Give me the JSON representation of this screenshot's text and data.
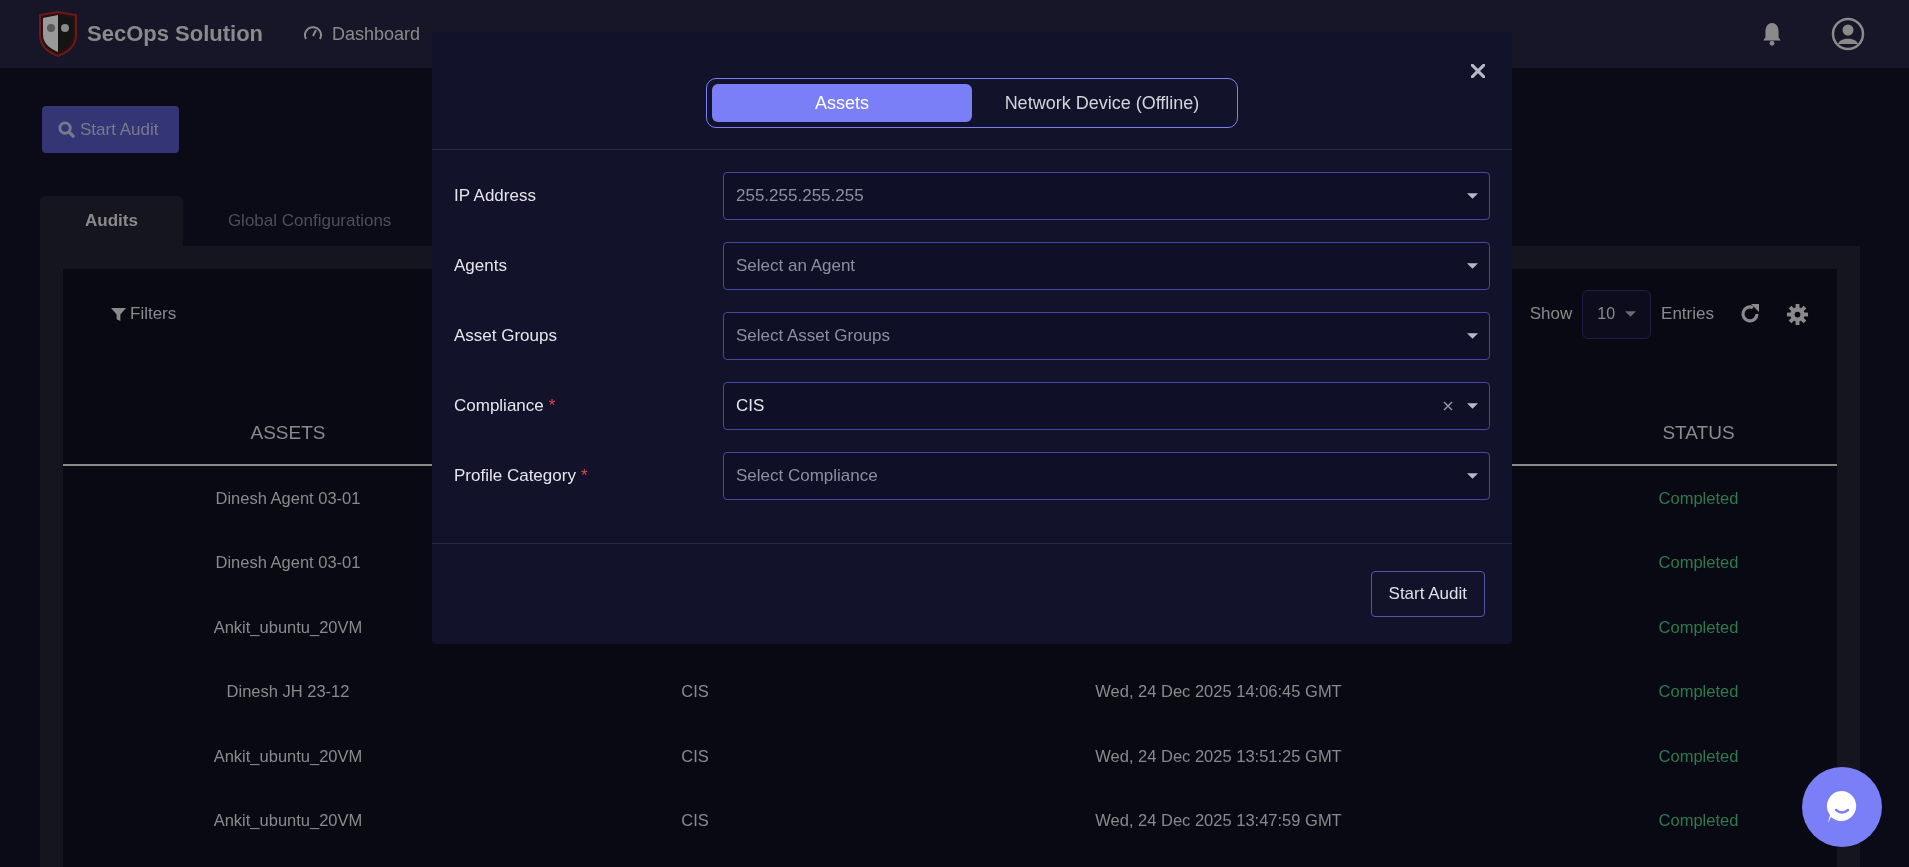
{
  "nav": {
    "brand": "SecOps Solution",
    "items": [
      {
        "label": "Dashboard"
      }
    ]
  },
  "start_audit_button": "Start Audit",
  "tabs": [
    {
      "label": "Audits",
      "selected": true
    },
    {
      "label": "Global Configurations",
      "selected": false
    }
  ],
  "toolbar": {
    "filters": "Filters",
    "show_label": "Show",
    "page_size": "10",
    "entries_label": "Entries"
  },
  "table": {
    "columns": {
      "assets": "ASSETS",
      "status": "STATUS"
    },
    "rows": [
      {
        "assets": "Dinesh Agent 03-01",
        "status": "Completed"
      },
      {
        "assets": "Dinesh Agent 03-01",
        "status": "Completed"
      },
      {
        "assets": "Ankit_ubuntu_20VM",
        "status": "Completed"
      },
      {
        "assets": "Dinesh JH 23-12",
        "column_2": "CIS",
        "column_3": "Wed, 24 Dec 2025 14:06:45 GMT",
        "status": "Completed"
      },
      {
        "assets": "Ankit_ubuntu_20VM",
        "column_2": "CIS",
        "column_3": "Wed, 24 Dec 2025 13:51:25 GMT",
        "status": "Completed"
      },
      {
        "assets": "Ankit_ubuntu_20VM",
        "column_2": "CIS",
        "column_3": "Wed, 24 Dec 2025 13:47:59 GMT",
        "status": "Completed"
      }
    ]
  },
  "modal": {
    "toggle": [
      {
        "label": "Assets",
        "selected": true
      },
      {
        "label": "Network Device (Offline)",
        "selected": false
      }
    ],
    "fields": [
      {
        "label": "IP Address",
        "placeholder": "255.255.255.255"
      },
      {
        "label": "Agents",
        "placeholder": "Select an Agent"
      },
      {
        "label": "Asset Groups",
        "placeholder": "Select Asset Groups"
      },
      {
        "label": "Compliance",
        "required_mark": "*",
        "value": "CIS",
        "clearable": true
      },
      {
        "label": "Profile Category",
        "required_mark": "*",
        "placeholder": "Select Compliance"
      }
    ],
    "submit_button": "Start Audit"
  }
}
